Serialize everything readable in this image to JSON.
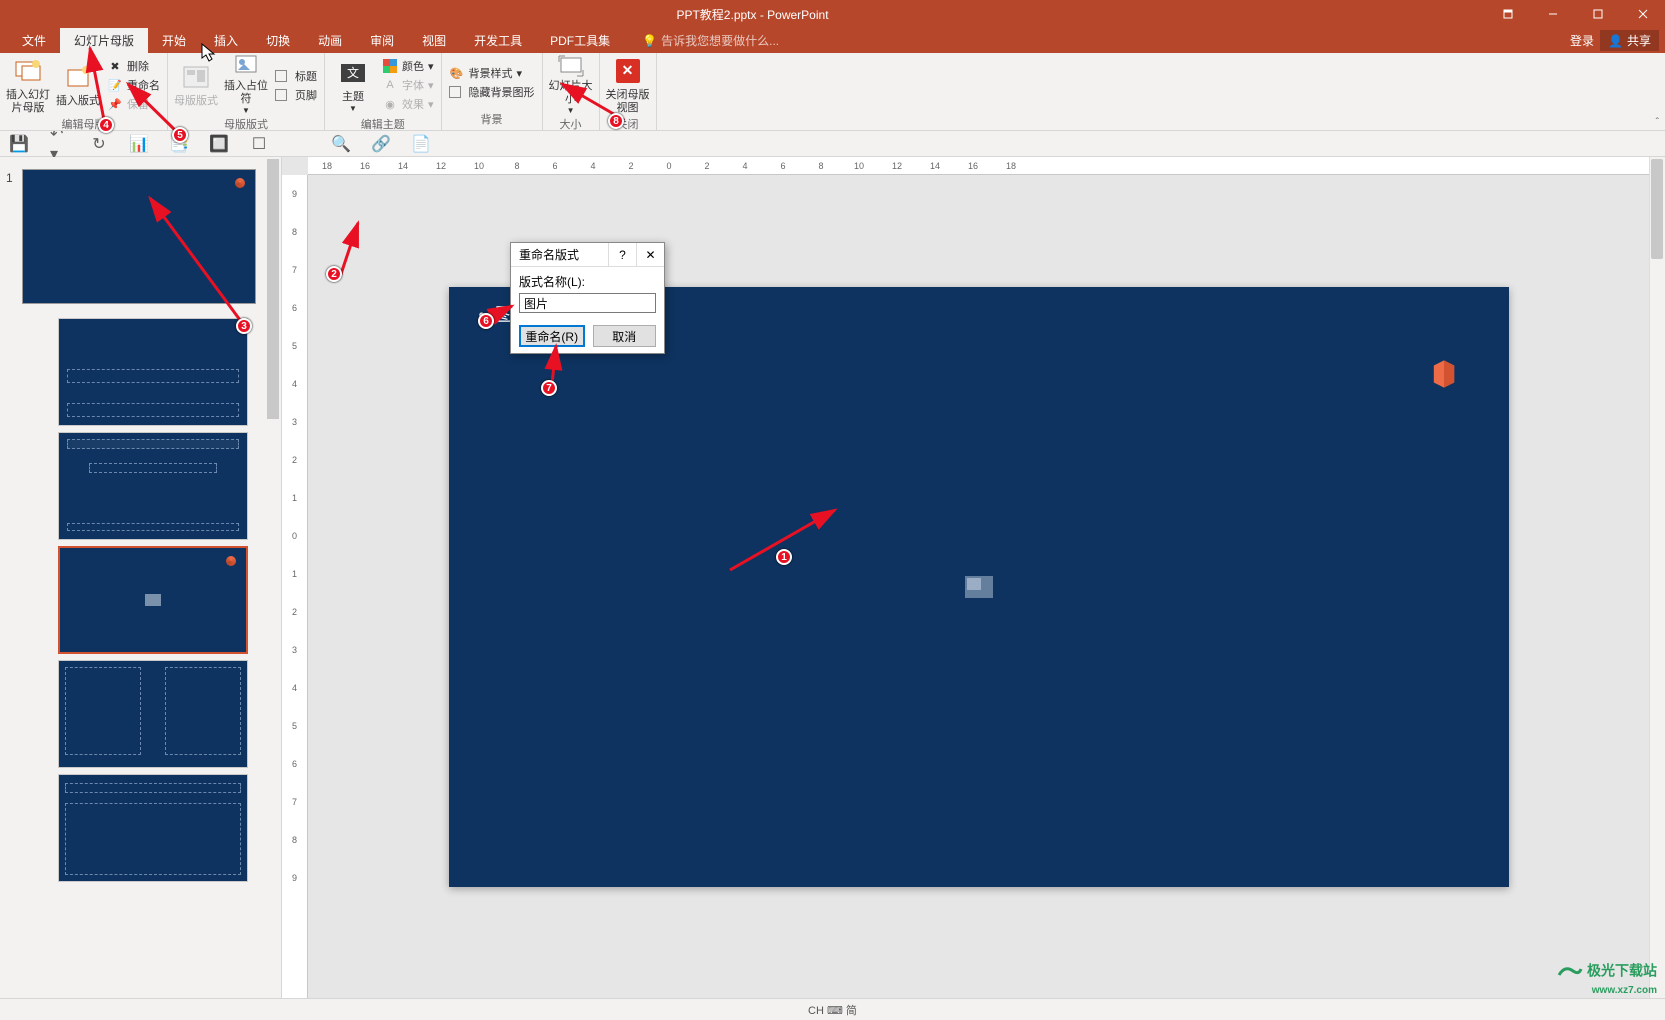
{
  "title": "PPT教程2.pptx - PowerPoint",
  "win": {
    "login": "登录",
    "share": "共享"
  },
  "tabs": {
    "file": "文件",
    "master": "幻灯片母版",
    "home": "开始",
    "insert": "插入",
    "trans": "切换",
    "anim": "动画",
    "review": "审阅",
    "view": "视图",
    "dev": "开发工具",
    "pdf": "PDF工具集",
    "tellme": "告诉我您想要做什么..."
  },
  "ribbon": {
    "g1": {
      "insert_master": "插入幻灯片母版",
      "insert_layout": "插入版式",
      "label": "编辑母版",
      "delete": "删除",
      "rename": "重命名",
      "preserve": "保留"
    },
    "g2": {
      "master_layout": "母版版式",
      "placeholder": "插入占位符",
      "title": "标题",
      "footer": "页脚",
      "label": "母版版式"
    },
    "g3": {
      "themes": "主题",
      "colors": "颜色",
      "fonts": "字体",
      "effects": "效果",
      "label": "编辑主题"
    },
    "g4": {
      "bg_style": "背景样式",
      "hide_bg": "隐藏背景图形",
      "label": "背景"
    },
    "g5": {
      "slide_size": "幻灯片大小",
      "label": "大小"
    },
    "g6": {
      "close": "关闭母版视图",
      "label": "关闭"
    }
  },
  "dialog": {
    "title": "重命名版式",
    "help": "?",
    "label": "版式名称(L):",
    "value": "图片",
    "rename": "重命名(R)",
    "cancel": "取消"
  },
  "slide": {
    "title": "图片"
  },
  "status": {
    "ime": "CH ⌨ 简"
  },
  "ruler_h": [
    "18",
    "16",
    "14",
    "12",
    "10",
    "8",
    "6",
    "4",
    "2",
    "0",
    "2",
    "4",
    "6",
    "8",
    "10",
    "12",
    "14",
    "16",
    "18"
  ],
  "ruler_v": [
    "9",
    "8",
    "7",
    "6",
    "5",
    "4",
    "3",
    "2",
    "1",
    "0",
    "1",
    "2",
    "3",
    "4",
    "5",
    "6",
    "7",
    "8",
    "9"
  ],
  "watermark": {
    "brand": "极光下载站",
    "url": "www.xz7.com"
  },
  "annot": [
    "1",
    "2",
    "3",
    "4",
    "5",
    "6",
    "7",
    "8"
  ]
}
